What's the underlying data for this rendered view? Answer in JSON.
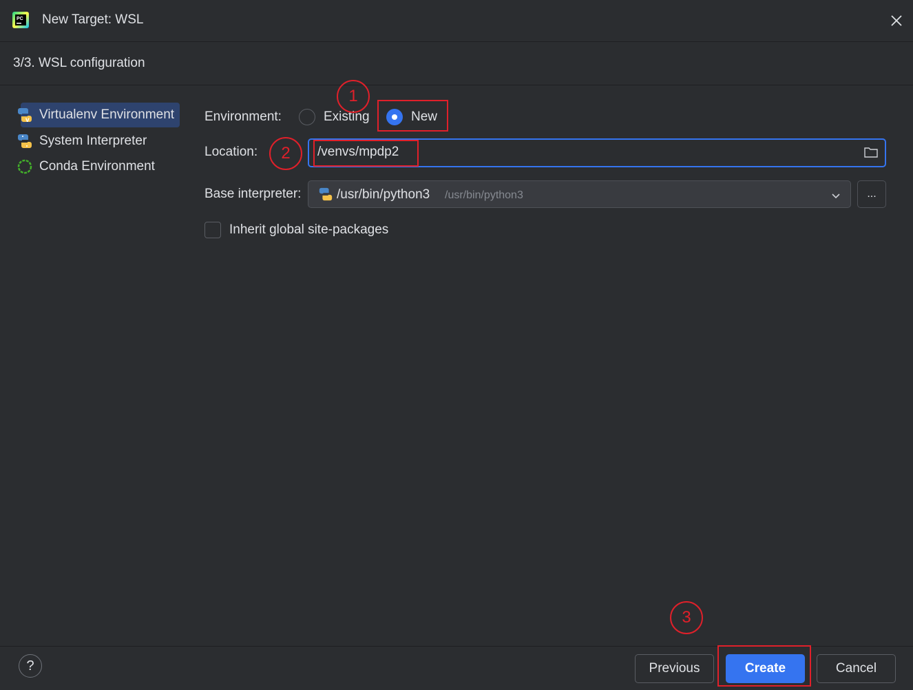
{
  "window": {
    "title": "New Target: WSL",
    "close_icon": "close-icon"
  },
  "step": {
    "label": "3/3. WSL configuration"
  },
  "sidebar": {
    "items": [
      {
        "label": "Virtualenv Environment",
        "icon": "virtualenv-icon",
        "selected": true
      },
      {
        "label": "System Interpreter",
        "icon": "python-icon",
        "selected": false
      },
      {
        "label": "Conda Environment",
        "icon": "conda-icon",
        "selected": false
      }
    ]
  },
  "form": {
    "environment_label": "Environment:",
    "radio_existing": "Existing",
    "radio_new": "New",
    "selected_option": "New",
    "location_label": "Location:",
    "location_value": "/venvs/mpdp2",
    "base_label": "Base interpreter:",
    "base_value": "/usr/bin/python3",
    "base_hint": "/usr/bin/python3",
    "browse_label": "...",
    "inherit_label": "Inherit global site-packages",
    "inherit_checked": false
  },
  "footer": {
    "help_label": "?",
    "previous_label": "Previous",
    "create_label": "Create",
    "cancel_label": "Cancel"
  },
  "annotations": {
    "marker1": "1",
    "marker2": "2",
    "marker3": "3"
  },
  "colors": {
    "background": "#2b2d30",
    "accent": "#3574f0",
    "annotation": "#e0202a",
    "selection": "#2e436e"
  }
}
